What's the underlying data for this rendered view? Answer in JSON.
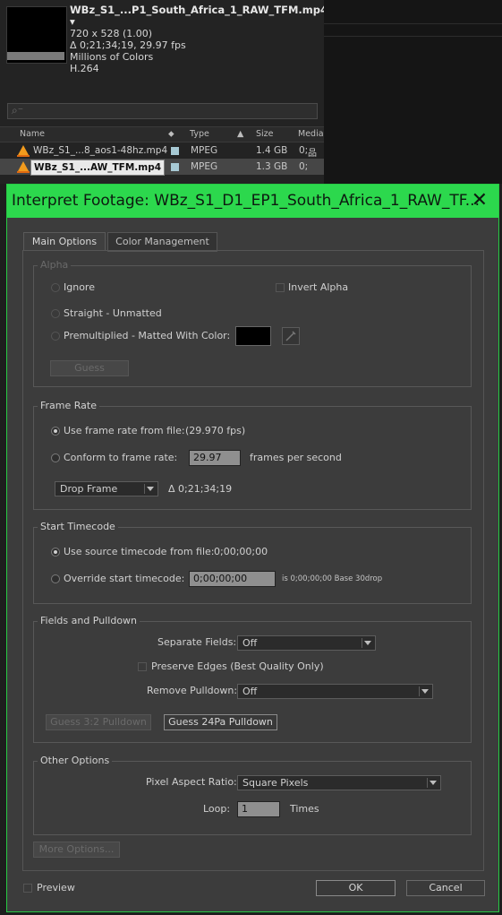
{
  "project_panel": {
    "file_name": "WBz_S1_...P1_South_Africa_1_RAW_TFM.mp4 ▾",
    "dimensions": "720 x 528 (1.00)",
    "duration": "Δ 0;21;34;19, 29.97 fps",
    "colors": "Millions of Colors",
    "codec": "H.264",
    "search_placeholder": "⌕⁻",
    "columns": [
      "Name",
      "Type",
      "Size",
      "Media"
    ],
    "rows": [
      {
        "name": "WBz_S1_...8_aos1-48hz.mp4",
        "type": "MPEG",
        "size": "1.4 GB",
        "media": "0;"
      },
      {
        "name": "WBz_S1_...AW_TFM.mp4",
        "type": "MPEG",
        "size": "1.3 GB",
        "media": "0;"
      }
    ]
  },
  "dialog": {
    "title": "Interpret Footage: WBz_S1_D1_EP1_South_Africa_1_RAW_TF...",
    "close": "✕",
    "tabs": [
      "Main Options",
      "Color Management"
    ],
    "alpha": {
      "label": "Alpha",
      "ignore": "Ignore",
      "invert": "Invert Alpha",
      "straight": "Straight - Unmatted",
      "premultiplied": "Premultiplied - Matted With Color:",
      "guess": "Guess"
    },
    "frame_rate": {
      "label": "Frame Rate",
      "use_file": "Use frame rate from file:",
      "file_value": "(29.970 fps)",
      "conform": "Conform to frame rate:",
      "conform_value": "29.97",
      "unit": "frames per second",
      "drop_frame": "Drop Frame",
      "duration": "Δ 0;21;34;19"
    },
    "start_timecode": {
      "label": "Start Timecode",
      "use_source": "Use source timecode from file:",
      "source_value": "0;00;00;00",
      "override": "Override start timecode:",
      "override_value": "0;00;00;00",
      "note": "is 0;00;00;00  Base 30drop"
    },
    "fields": {
      "label": "Fields and Pulldown",
      "separate": "Separate Fields:",
      "separate_value": "Off",
      "preserve": "Preserve Edges (Best Quality Only)",
      "remove": "Remove Pulldown:",
      "remove_value": "Off",
      "guess32": "Guess 3:2 Pulldown",
      "guess24": "Guess 24Pa Pulldown"
    },
    "other": {
      "label": "Other Options",
      "par": "Pixel Aspect Ratio:",
      "par_value": "Square Pixels",
      "loop": "Loop:",
      "loop_value": "1",
      "times": "Times"
    },
    "more_options": "More Options...",
    "preview": "Preview",
    "ok": "OK",
    "cancel": "Cancel"
  }
}
